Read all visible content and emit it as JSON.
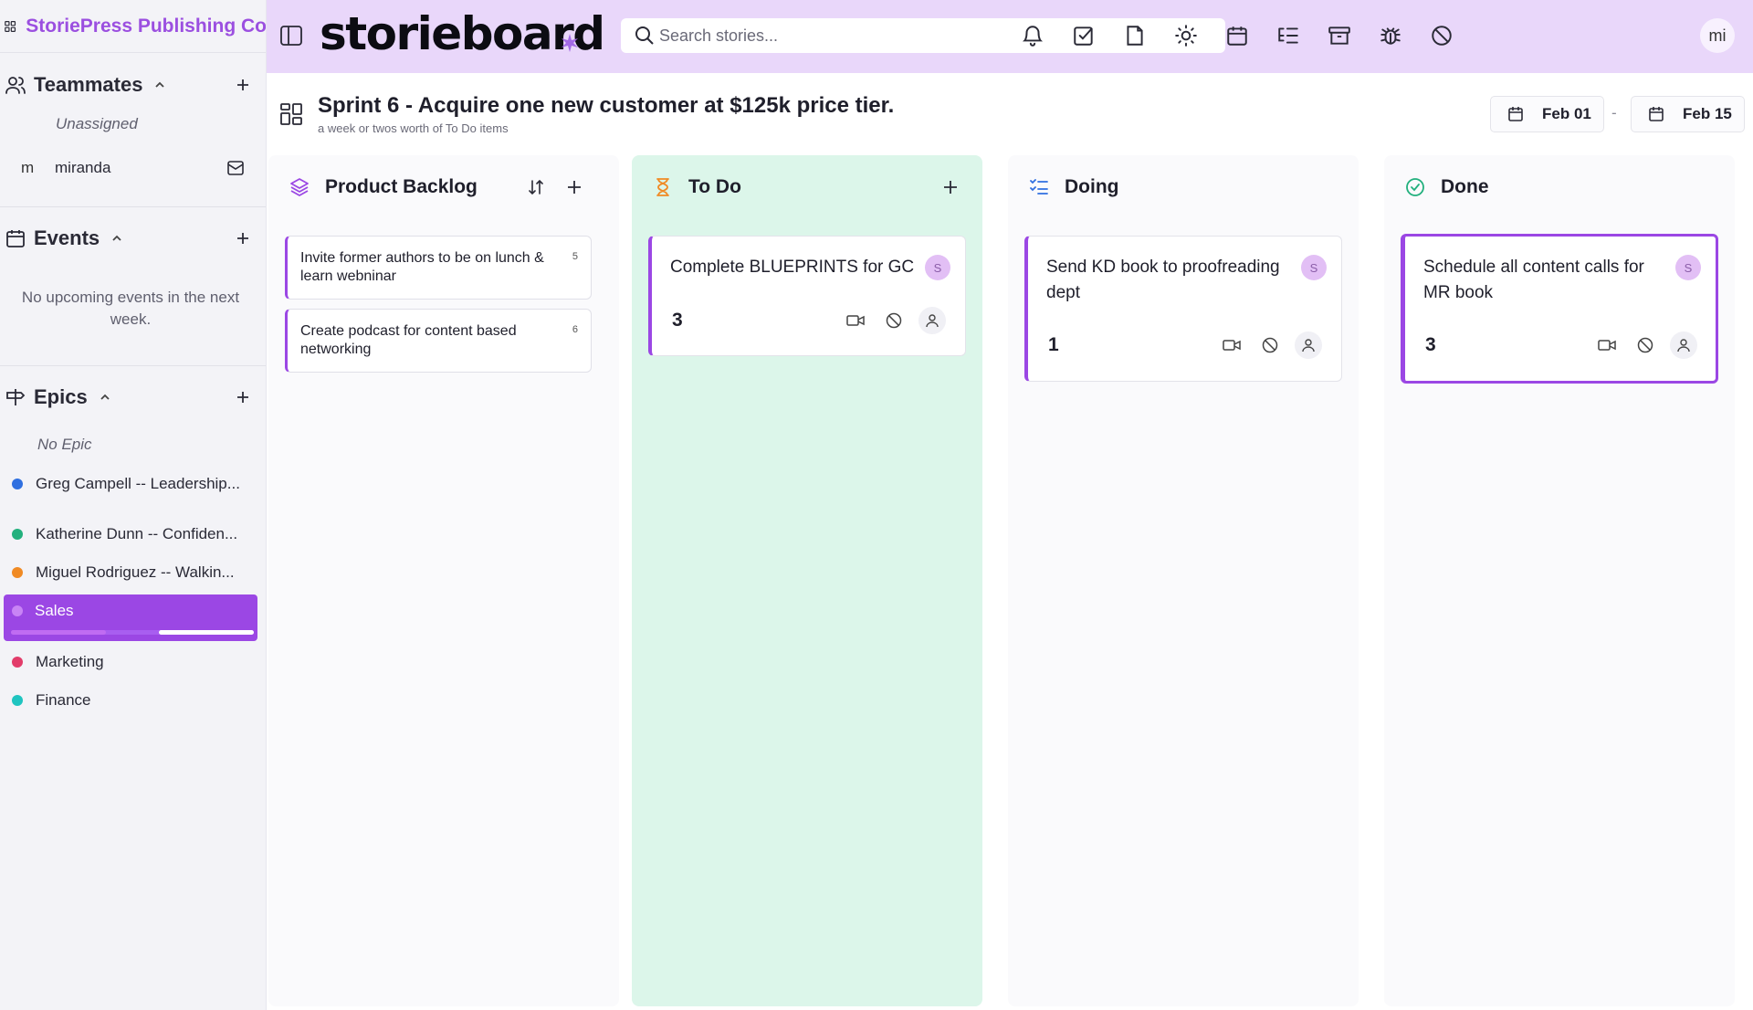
{
  "sidebar": {
    "org_name": "StoriePress Publishing Co",
    "teammates": {
      "title": "Teammates",
      "unassigned": "Unassigned",
      "members": [
        {
          "initial": "m",
          "name": "miranda"
        }
      ]
    },
    "events": {
      "title": "Events",
      "empty_text": "No upcoming events in the next week."
    },
    "epics": {
      "title": "Epics",
      "no_epic": "No Epic",
      "items": [
        {
          "label": "Greg Campell -- Leadership...",
          "color": "#2f6fe0"
        },
        {
          "label": "Katherine Dunn -- Confiden...",
          "color": "#22b07d"
        },
        {
          "label": "Miguel Rodriguez -- Walkin...",
          "color": "#f08a24"
        },
        {
          "label": "Sales",
          "color": "#c884f5",
          "active": true
        },
        {
          "label": "Marketing",
          "color": "#e23c6a"
        },
        {
          "label": "Finance",
          "color": "#1fc4c0"
        }
      ]
    }
  },
  "topbar": {
    "logo": "storieboard",
    "search_placeholder": "Search stories...",
    "avatar_initials": "mi",
    "icons": [
      "bell-icon",
      "checkbox-icon",
      "document-icon",
      "sun-icon",
      "calendar-icon",
      "list-tree-icon",
      "archive-icon",
      "bug-icon",
      "ban-icon"
    ]
  },
  "sprint": {
    "title": "Sprint 6 - Acquire one new customer at $125k price tier.",
    "subtitle": "a week or twos worth of To Do items",
    "start_date": "Feb 01",
    "date_separator": "-",
    "end_date": "Feb 15"
  },
  "columns": {
    "backlog": {
      "title": "Product Backlog",
      "cards": [
        {
          "text": "Invite former authors to be on lunch & learn webninar",
          "num": "5"
        },
        {
          "text": "Create podcast for content based networking",
          "num": "6"
        }
      ]
    },
    "todo": {
      "title": "To Do",
      "cards": [
        {
          "title": "Complete BLUEPRINTS for GC",
          "avatar": "S",
          "points": "3"
        }
      ]
    },
    "doing": {
      "title": "Doing",
      "cards": [
        {
          "title": "Send KD book to proofreading dept",
          "avatar": "S",
          "points": "1"
        }
      ]
    },
    "done": {
      "title": "Done",
      "cards": [
        {
          "title": "Schedule all content calls for MR book",
          "avatar": "S",
          "points": "3"
        }
      ]
    }
  },
  "colors": {
    "accent": "#9b47e4",
    "topbar_bg": "#e9d7fa",
    "todo_bg": "#dcf6ea",
    "sidebar_bg": "#f3f3f7"
  }
}
